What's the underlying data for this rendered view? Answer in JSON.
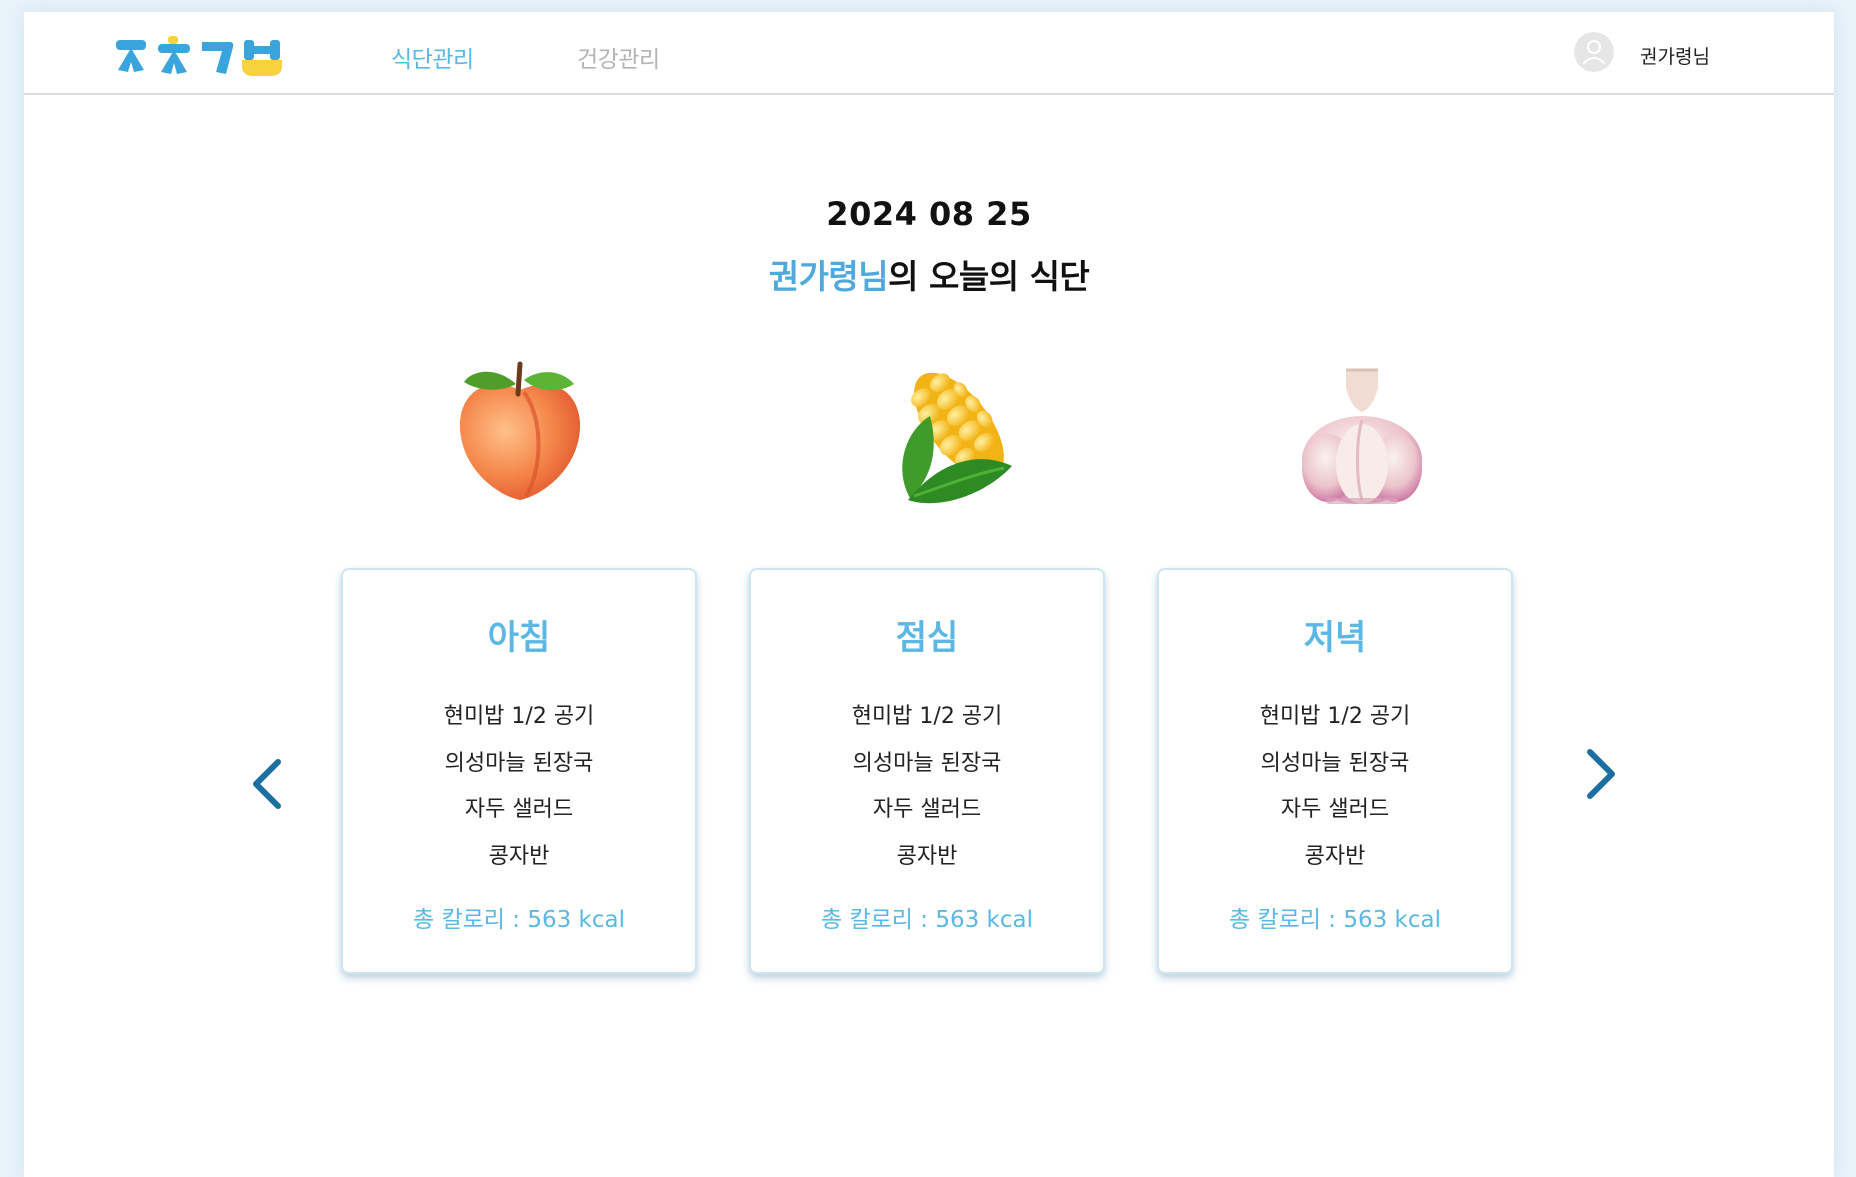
{
  "header": {
    "nav": [
      {
        "label": "식단관리",
        "active": true
      },
      {
        "label": "건강관리",
        "active": false
      }
    ],
    "user_name": "권가령님",
    "avatar_icon": "user-avatar-icon"
  },
  "main": {
    "date": "2024 08 25",
    "subtitle_name": "권가령님",
    "subtitle_rest": "의 오늘의 식단",
    "prev_icon": "chevron-left-icon",
    "next_icon": "chevron-right-icon"
  },
  "meals": [
    {
      "title": "아침",
      "icon": "peach-icon",
      "items": [
        "현미밥 1/2 공기",
        "의성마늘 된장국",
        "자두 샐러드",
        "콩자반"
      ],
      "calories": "총 칼로리 : 563 kcal"
    },
    {
      "title": "점심",
      "icon": "corn-icon",
      "items": [
        "현미밥 1/2 공기",
        "의성마늘 된장국",
        "자두 샐러드",
        "콩자반"
      ],
      "calories": "총 칼로리 : 563 kcal"
    },
    {
      "title": "저녁",
      "icon": "garlic-icon",
      "items": [
        "현미밥 1/2 공기",
        "의성마늘 된장국",
        "자두 샐러드",
        "콩자반"
      ],
      "calories": "총 칼로리 : 563 kcal"
    }
  ],
  "colors": {
    "accent": "#5bb8e4",
    "arrow": "#1c6fa0",
    "inactive_nav": "#b4b4b4",
    "logo_blue": "#3aa5dc",
    "logo_yellow": "#f7d13e"
  }
}
